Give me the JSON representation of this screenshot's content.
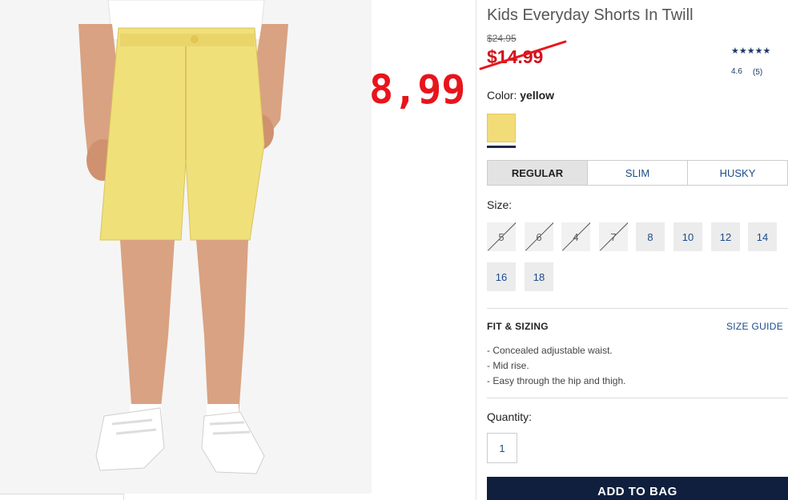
{
  "product": {
    "title": "Kids Everyday Shorts In Twill",
    "original_price": "$24.95",
    "sale_price": "$14.99",
    "overlay_price": "8,99",
    "rating_stars": "★★★★★",
    "rating_value": "4.6",
    "rating_count": "(5)"
  },
  "color": {
    "label": "Color:",
    "value": "yellow",
    "swatch_hex": "#f2dc78"
  },
  "fit": {
    "tabs": [
      {
        "label": "REGULAR",
        "active": true
      },
      {
        "label": "SLIM",
        "active": false
      },
      {
        "label": "HUSKY",
        "active": false
      }
    ]
  },
  "size": {
    "label": "Size:",
    "options": [
      {
        "label": "5",
        "available": false
      },
      {
        "label": "6",
        "available": false
      },
      {
        "label": "4",
        "available": false
      },
      {
        "label": "7",
        "available": false
      },
      {
        "label": "8",
        "available": true
      },
      {
        "label": "10",
        "available": true
      },
      {
        "label": "12",
        "available": true
      },
      {
        "label": "14",
        "available": true
      },
      {
        "label": "16",
        "available": true
      },
      {
        "label": "18",
        "available": true
      }
    ]
  },
  "fit_sizing": {
    "heading": "FIT & SIZING",
    "size_guide_link": "SIZE GUIDE",
    "features": [
      "- Concealed adjustable waist.",
      "- Mid rise.",
      "- Easy through the hip and thigh."
    ]
  },
  "quantity": {
    "label": "Quantity:",
    "value": "1"
  },
  "actions": {
    "add_to_bag": "ADD TO BAG"
  },
  "colors": {
    "brand_navy": "#0f1f3d",
    "sale_red": "#d0141c",
    "link_blue": "#1b4b8a"
  }
}
